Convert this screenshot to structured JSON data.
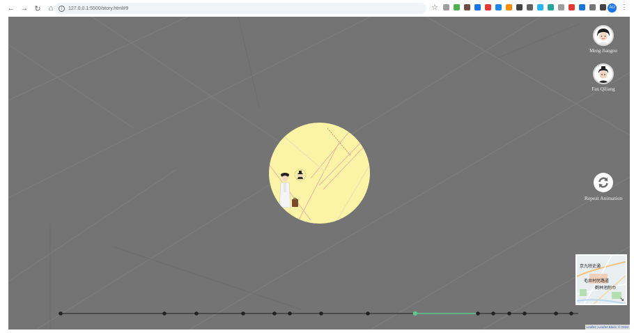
{
  "browser": {
    "url": "127.0.0.1:5500/story.html#9",
    "nav_icons": [
      "back-arrow-icon",
      "forward-arrow-icon",
      "reload-icon",
      "home-icon"
    ],
    "extensions": [
      "#9e9e9e",
      "#4caf50",
      "#6d4c41",
      "#1a73e8",
      "#e53935",
      "#1e88e5",
      "#fb8c00",
      "#424242",
      "#616161",
      "#29b6f6",
      "#26a69a",
      "#9e9e9e",
      "#e53935",
      "#1976d2",
      "#757575",
      "#424242"
    ],
    "profile_initials": "AU"
  },
  "characters": [
    {
      "name": "Meng Jiangnu",
      "icon": "woman-portrait-icon"
    },
    {
      "name": "Fan Qiliang",
      "icon": "man-portrait-icon"
    }
  ],
  "controls": {
    "repeat_label": "Repeat Animation",
    "repeat_icon": "refresh-icon"
  },
  "minimap": {
    "labels": [
      "京九特史通",
      "毛井村民路道",
      "鹤林池附巾"
    ],
    "toggle_icon": "arrow-diagonal-icon"
  },
  "attribution": "Leaflet | Leaflet Black, © OSM",
  "timeline": {
    "active_index": 11,
    "stop_count": 17,
    "colors": {
      "line": "#222222",
      "done": "#5cc88a",
      "active": "#5cc88a"
    }
  },
  "colors": {
    "spotlight": "#fbf3a5",
    "map_bg": "#747474"
  }
}
